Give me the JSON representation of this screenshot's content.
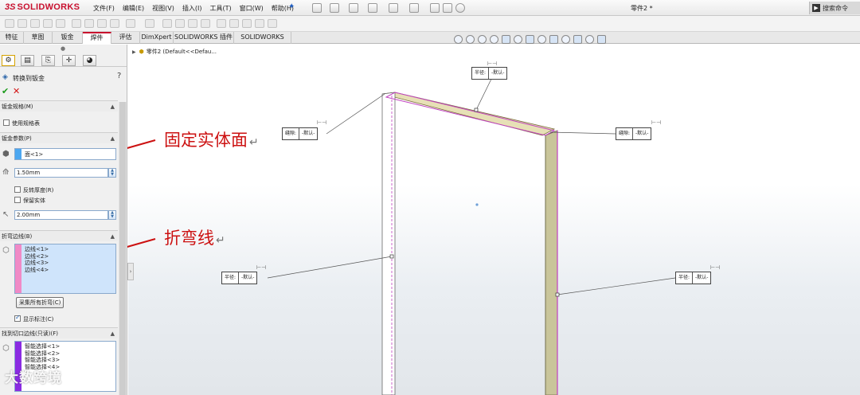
{
  "app": {
    "logo_prefix": "3S",
    "logo_name": "SOLIDWORKS",
    "document_title": "零件2 *",
    "search_label": "搜索命令"
  },
  "menu": [
    "文件(F)",
    "编辑(E)",
    "视图(V)",
    "插入(I)",
    "工具(T)",
    "窗口(W)",
    "帮助(H)"
  ],
  "tabs": [
    {
      "label": "特征",
      "active": false
    },
    {
      "label": "草图",
      "active": false
    },
    {
      "label": "钣金",
      "active": false
    },
    {
      "label": "焊件",
      "active": true
    },
    {
      "label": "评估",
      "active": false
    },
    {
      "label": "DimXpert",
      "active": false
    },
    {
      "label": "SOLIDWORKS 插件",
      "active": false
    },
    {
      "label": "SOLIDWORKS MBD",
      "active": false
    }
  ],
  "property_manager": {
    "title": "转换到钣金",
    "help": "?",
    "sections": {
      "gauge": {
        "title": "钣金规格(M)",
        "use_table": "使用规格表",
        "use_table_checked": false
      },
      "params": {
        "title": "钣金参数(P)",
        "fixed_face": "面<1>",
        "thickness": "1.50mm",
        "reverse_thickness": "反转厚度(R)",
        "keep_body": "保留实体",
        "radius": "2.00mm"
      },
      "bend_edges": {
        "title": "折弯边线(B)",
        "items": [
          "边线<1>",
          "边线<2>",
          "边线<3>",
          "边线<4>"
        ],
        "collect_button": "采集所有折弯(C)",
        "show_callouts": "显示标注(C)",
        "show_callouts_checked": true,
        "stripe_color": "#f08ac6"
      },
      "rip_edges": {
        "title": "找到切口边线(只读)(F)",
        "items": [
          "智能选择<1>",
          "智能选择<2>",
          "智能选择<3>",
          "智能选择<4>"
        ],
        "stripe_color": "#8a2be2"
      }
    }
  },
  "tree": {
    "label": "零件2  (Default<<Defau..."
  },
  "callouts": {
    "top": {
      "key": "半径:",
      "value": "-默认-"
    },
    "left_upper": {
      "key": "缝隙:",
      "value": "-默认-"
    },
    "right_upper": {
      "key": "缝隙:",
      "value": "-默认-"
    },
    "left_lower": {
      "key": "半径:",
      "value": "-默认-"
    },
    "right_lower": {
      "key": "半径:",
      "value": "-默认-"
    }
  },
  "annotations": {
    "fixed_face": "固定实体面",
    "bend_line": "折弯线",
    "return_mark": "↵"
  },
  "watermark": "大数跨境",
  "colors": {
    "accent": "#c8102e",
    "annotation": "#cc1111",
    "part_edge": "#c040c0",
    "part_face": "#c9c59a"
  }
}
